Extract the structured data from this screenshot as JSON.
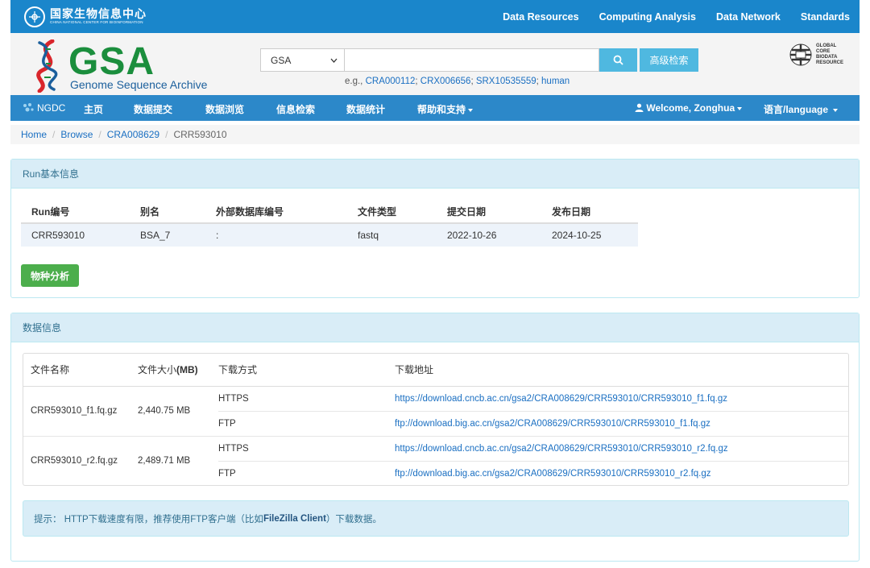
{
  "topbar": {
    "org_cn": "国家生物信息中心",
    "org_en": "CHINA NATIONAL CENTER FOR BIOINFORMATION",
    "nav": [
      "Data Resources",
      "Computing Analysis",
      "Data Network",
      "Standards"
    ]
  },
  "header": {
    "logo_text": "GSA",
    "logo_sub": "Genome Sequence Archive",
    "search_select": "GSA",
    "search_value": "",
    "advanced_label": "高级检索",
    "eg_prefix": "e.g., ",
    "eg_links": [
      "CRA000112",
      "CRX006656",
      "SRX10535559",
      "human"
    ],
    "gcbr_lines": [
      "GLOBAL",
      "CORE",
      "BIODATA",
      "RESOURCE"
    ]
  },
  "mainnav": {
    "ngdc": "NGDC",
    "items": [
      "主页",
      "数据提交",
      "数据浏览",
      "信息检索",
      "数据统计",
      "帮助和支持"
    ],
    "welcome": "Welcome, Zonghua",
    "language": "语言/language"
  },
  "breadcrumb": [
    "Home",
    "Browse",
    "CRA008629",
    "CRR593010"
  ],
  "run_panel": {
    "title": "Run基本信息",
    "headers": [
      "Run编号",
      "别名",
      "外部数据库编号",
      "文件类型",
      "提交日期",
      "发布日期"
    ],
    "row": [
      "CRR593010",
      "BSA_7",
      ":",
      "fastq",
      "2022-10-26",
      "2024-10-25"
    ],
    "species_button": "物种分析"
  },
  "data_panel": {
    "title": "数据信息",
    "headers": [
      "文件名称",
      "文件大小",
      "(MB)",
      "下载方式",
      "下载地址"
    ],
    "files": [
      {
        "name": "CRR593010_f1.fq.gz",
        "size": "2,440.75 MB",
        "downloads": [
          {
            "method": "HTTPS",
            "url": "https://download.cncb.ac.cn/gsa2/CRA008629/CRR593010/CRR593010_f1.fq.gz"
          },
          {
            "method": "FTP",
            "url": "ftp://download.big.ac.cn/gsa2/CRA008629/CRR593010/CRR593010_f1.fq.gz"
          }
        ]
      },
      {
        "name": "CRR593010_r2.fq.gz",
        "size": "2,489.71 MB",
        "downloads": [
          {
            "method": "HTTPS",
            "url": "https://download.cncb.ac.cn/gsa2/CRA008629/CRR593010/CRR593010_r2.fq.gz"
          },
          {
            "method": "FTP",
            "url": "ftp://download.big.ac.cn/gsa2/CRA008629/CRR593010/CRR593010_r2.fq.gz"
          }
        ]
      }
    ],
    "tip_prefix": "提示：  HTTP下载速度有限，推荐使用FTP客户端（比如 ",
    "tip_link": "FileZilla Client",
    "tip_suffix": "）下载数据。"
  }
}
